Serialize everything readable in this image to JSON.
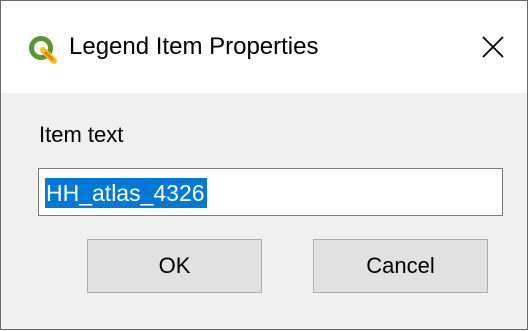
{
  "window": {
    "title": "Legend Item Properties",
    "app_icon": "qgis-logo-icon",
    "close_icon": "close-icon"
  },
  "form": {
    "item_text_label": "Item text",
    "item_text_value": "HH_atlas_4326"
  },
  "buttons": {
    "ok_label": "OK",
    "cancel_label": "Cancel"
  },
  "colors": {
    "selection": "#0078d7",
    "qgis_green": "#589632",
    "qgis_yellow": "#ee7913"
  }
}
